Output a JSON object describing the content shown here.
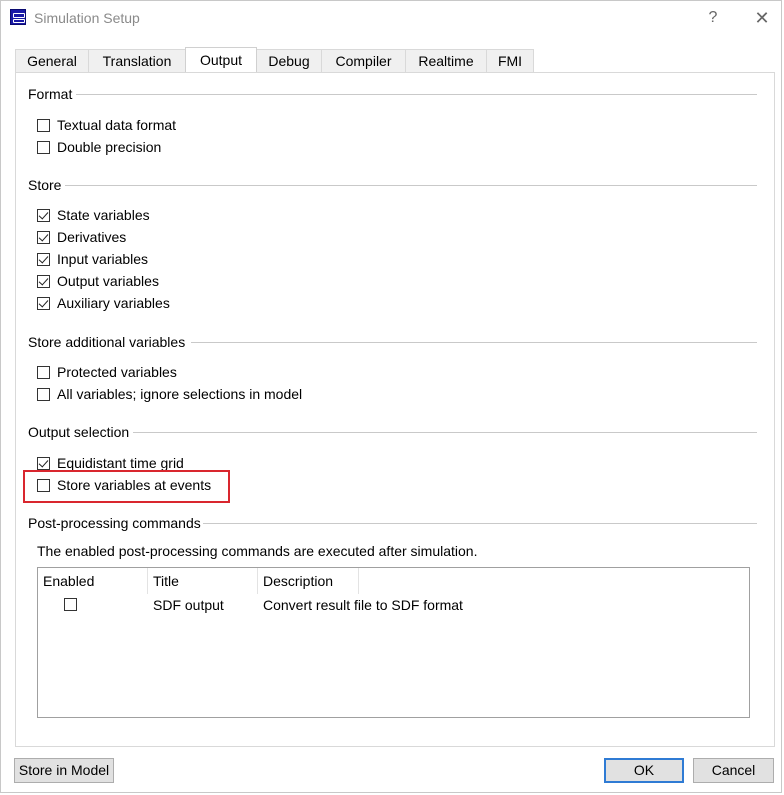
{
  "window": {
    "title": "Simulation Setup",
    "help_label": "?",
    "close_label": "✕"
  },
  "tabs": [
    {
      "label": "General"
    },
    {
      "label": "Translation"
    },
    {
      "label": "Output",
      "active": true
    },
    {
      "label": "Debug"
    },
    {
      "label": "Compiler"
    },
    {
      "label": "Realtime"
    },
    {
      "label": "FMI"
    }
  ],
  "format": {
    "title": "Format",
    "items": [
      {
        "label": "Textual data format",
        "checked": false
      },
      {
        "label": "Double precision",
        "checked": false
      }
    ]
  },
  "store": {
    "title": "Store",
    "items": [
      {
        "label": "State variables",
        "checked": true
      },
      {
        "label": "Derivatives",
        "checked": true
      },
      {
        "label": "Input variables",
        "checked": true
      },
      {
        "label": "Output variables",
        "checked": true
      },
      {
        "label": "Auxiliary variables",
        "checked": true
      }
    ]
  },
  "store_additional": {
    "title": "Store additional variables",
    "items": [
      {
        "label": "Protected variables",
        "checked": false
      },
      {
        "label": "All variables; ignore selections in model",
        "checked": false
      }
    ]
  },
  "output_selection": {
    "title": "Output selection",
    "items": [
      {
        "label": "Equidistant time grid",
        "checked": true
      },
      {
        "label": "Store variables at events",
        "checked": false
      }
    ]
  },
  "post_processing": {
    "title": "Post-processing commands",
    "description": "The enabled post-processing commands are executed after simulation.",
    "columns": [
      "Enabled",
      "Title",
      "Description"
    ],
    "rows": [
      {
        "enabled": false,
        "title": "SDF output",
        "description": "Convert result file to SDF format"
      }
    ]
  },
  "footer": {
    "store_in_model": "Store in Model",
    "ok": "OK",
    "cancel": "Cancel"
  },
  "colors": {
    "highlight": "#d9262e",
    "default_button_border": "#2f7bd4"
  }
}
